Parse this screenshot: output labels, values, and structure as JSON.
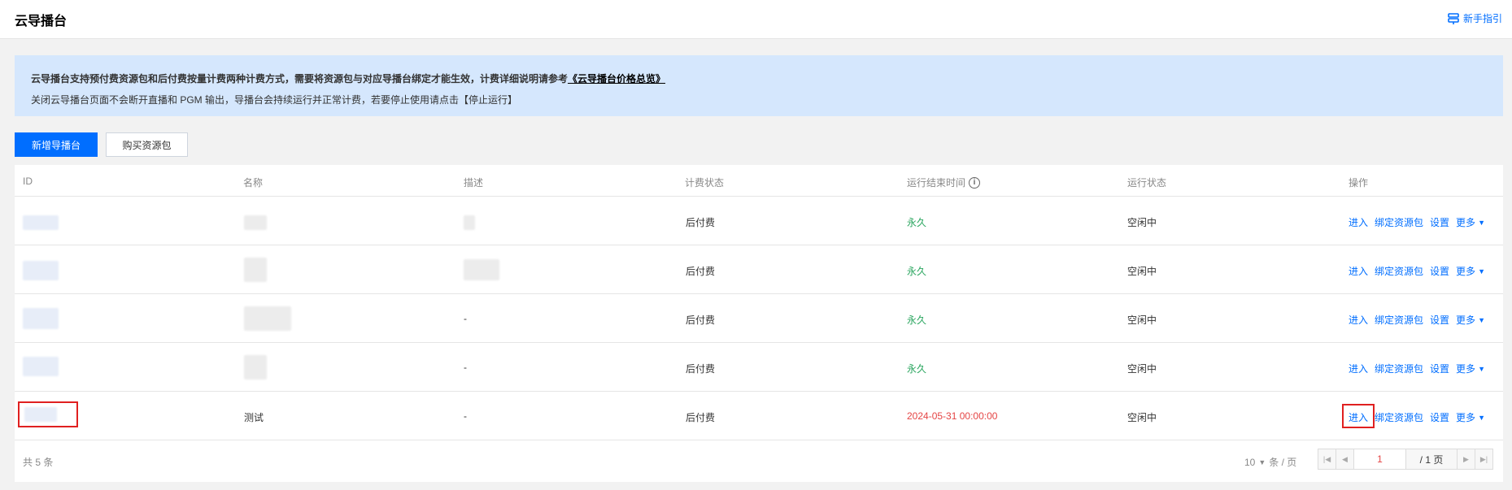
{
  "header": {
    "title": "云导播台",
    "guide_label": "新手指引"
  },
  "notice": {
    "line1_text": "云导播台支持预付费资源包和后付费按量计费两种计费方式，需要将资源包与对应导播台绑定才能生效，计费详细说明请参考",
    "line1_link": "《云导播台价格总览》",
    "line2_text": "关闭云导播台页面不会断开直播和 PGM 输出，导播台会持续运行并正常计费，若要停止使用请点击【停止运行】"
  },
  "toolbar": {
    "add_label": "新增导播台",
    "buy_label": "购买资源包"
  },
  "table": {
    "columns": [
      "ID",
      "名称",
      "描述",
      "计费状态",
      "运行结束时间",
      "运行状态",
      "操作"
    ],
    "rows": [
      {
        "name": "",
        "desc": "",
        "billing": "后付费",
        "end_time": "永久",
        "status": "空闲中"
      },
      {
        "name": "",
        "desc": "",
        "billing": "后付费",
        "end_time": "永久",
        "status": "空闲中"
      },
      {
        "name": "",
        "desc": "-",
        "billing": "后付费",
        "end_time": "永久",
        "status": "空闲中"
      },
      {
        "name": "",
        "desc": "-",
        "billing": "后付费",
        "end_time": "永久",
        "status": "空闲中"
      },
      {
        "name": "测试",
        "desc": "-",
        "billing": "后付费",
        "end_time": "2024-05-31 00:00:00",
        "status": "空闲中"
      }
    ],
    "actions": {
      "enter": "进入",
      "bind": "绑定资源包",
      "settings": "设置",
      "more": "更多"
    }
  },
  "pagination": {
    "total_text": "共 5 条",
    "page_size": "10",
    "page_size_unit": "条 / 页",
    "current_page": "1",
    "total_pages": "/ 1 页"
  },
  "colors": {
    "primary": "#006eff",
    "green": "#29a55e",
    "red": "#e54545",
    "notice_bg": "#d5e7fd"
  }
}
